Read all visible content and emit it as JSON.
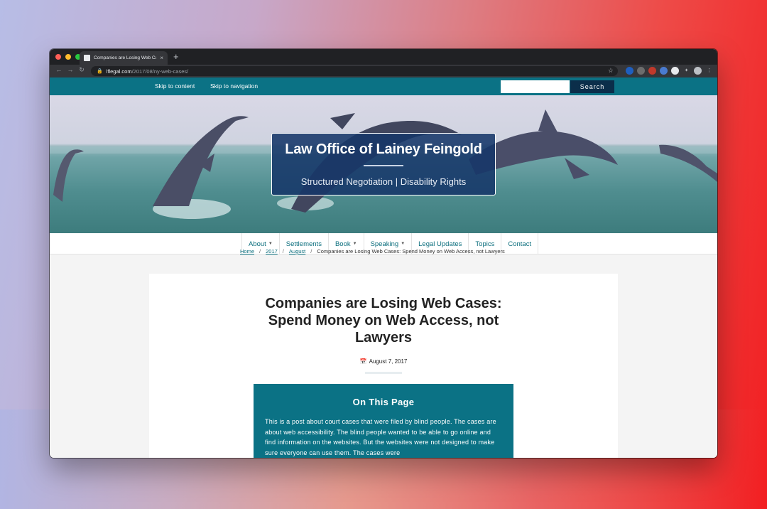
{
  "browser": {
    "tab_title": "Companies are Losing Web Ca",
    "tab_close": "×",
    "new_tab": "+",
    "url_host": "lflegal.com",
    "url_path": "/2017/08/ny-web-cases/",
    "icons": [
      "back-icon",
      "forward-icon",
      "reload-icon",
      "lock-icon",
      "star-icon",
      "extensions-icon",
      "profile-icon",
      "menu-icon"
    ]
  },
  "topbar": {
    "skip_content": "Skip to content",
    "skip_navigation": "Skip to navigation",
    "search_value": "",
    "search_label": "Search"
  },
  "header": {
    "site_title": "Law Office of Lainey Feingold",
    "tagline": "Structured Negotiation | Disability Rights"
  },
  "nav": {
    "items": [
      {
        "label": "About",
        "has_menu": true
      },
      {
        "label": "Settlements",
        "has_menu": false
      },
      {
        "label": "Book",
        "has_menu": true
      },
      {
        "label": "Speaking",
        "has_menu": true
      },
      {
        "label": "Legal Updates",
        "has_menu": false
      },
      {
        "label": "Topics",
        "has_menu": false
      },
      {
        "label": "Contact",
        "has_menu": false
      }
    ]
  },
  "breadcrumb": {
    "home": "Home",
    "year": "2017",
    "month": "August",
    "current": "Companies are Losing Web Cases: Spend Money on Web Access, not Lawyers",
    "separator": "/"
  },
  "article": {
    "title": "Companies are Losing Web Cases: Spend Money on Web Access, not Lawyers",
    "date": "August 7, 2017",
    "toc_heading": "On This Page",
    "toc_text": "This is a post about court cases that were filed by blind people.  The cases are about web accessibility.  The blind people wanted to be able to go online and find information on the websites. But the websites were not designed to make sure everyone can use them.  The cases were"
  },
  "colors": {
    "teal": "#0b7285",
    "navy_box": "#163769",
    "link": "#0b6e7d"
  }
}
